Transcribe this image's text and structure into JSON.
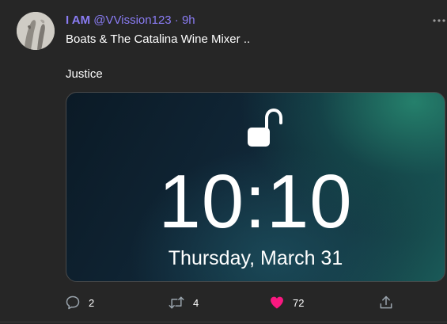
{
  "tweet": {
    "author": {
      "display_name": "I AM",
      "handle": "@VVission123",
      "separator": "·",
      "time": "9h"
    },
    "text_line_1": "Boats & The Catalina Wine Mixer ..",
    "text_line_2": "Justice",
    "media": {
      "time": "10:10",
      "date": "Thursday, March 31",
      "icon": "unlocked-padlock-icon"
    },
    "actions": {
      "reply_count": "2",
      "retweet_count": "4",
      "like_count": "72"
    },
    "colors": {
      "accent": "#8a7cf4",
      "like": "#f91880",
      "background": "#262626"
    }
  }
}
